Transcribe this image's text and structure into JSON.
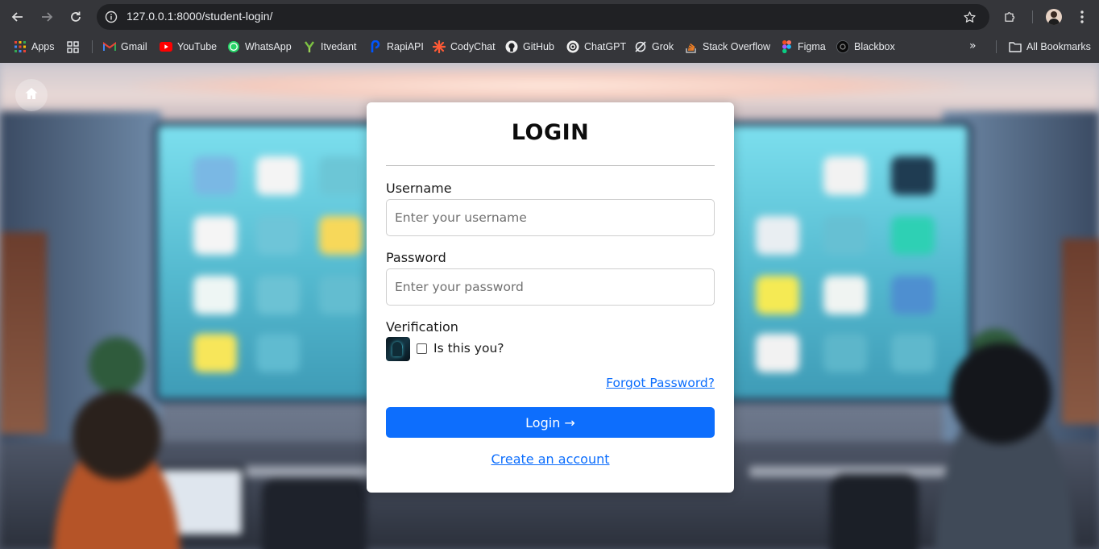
{
  "browser": {
    "url": "127.0.0.1:8000/student-login/",
    "bookmarks": [
      {
        "label": "Apps",
        "icon": "apps-grid-icon"
      },
      {
        "label": "",
        "icon": "tab-groups-icon"
      },
      {
        "label": "Gmail",
        "icon": "gmail-icon"
      },
      {
        "label": "YouTube",
        "icon": "youtube-icon"
      },
      {
        "label": "WhatsApp",
        "icon": "whatsapp-icon"
      },
      {
        "label": "Itvedant",
        "icon": "itvedant-icon"
      },
      {
        "label": "RapiAPI",
        "icon": "rapidapi-icon"
      },
      {
        "label": "CodyChat",
        "icon": "codychat-icon"
      },
      {
        "label": "GitHub",
        "icon": "github-icon"
      },
      {
        "label": "ChatGPT",
        "icon": "chatgpt-icon"
      },
      {
        "label": "Grok",
        "icon": "grok-icon"
      },
      {
        "label": "Stack Overflow",
        "icon": "stackoverflow-icon"
      },
      {
        "label": "Figma",
        "icon": "figma-icon"
      },
      {
        "label": "Blackbox",
        "icon": "blackbox-icon"
      }
    ],
    "more_bookmarks": "»",
    "all_bookmarks": "All Bookmarks"
  },
  "login": {
    "title": "LOGIN",
    "username_label": "Username",
    "username_placeholder": "Enter your username",
    "username_value": "",
    "password_label": "Password",
    "password_placeholder": "Enter your password",
    "password_value": "",
    "verification_label": "Verification",
    "verification_checkbox": "Is this you?",
    "forgot_password": "Forgot Password?",
    "login_button": "Login →",
    "create_account": "Create an account"
  },
  "colors": {
    "primary": "#0d6efd",
    "browser_bg": "#35363a",
    "omnibox_bg": "#202124"
  }
}
